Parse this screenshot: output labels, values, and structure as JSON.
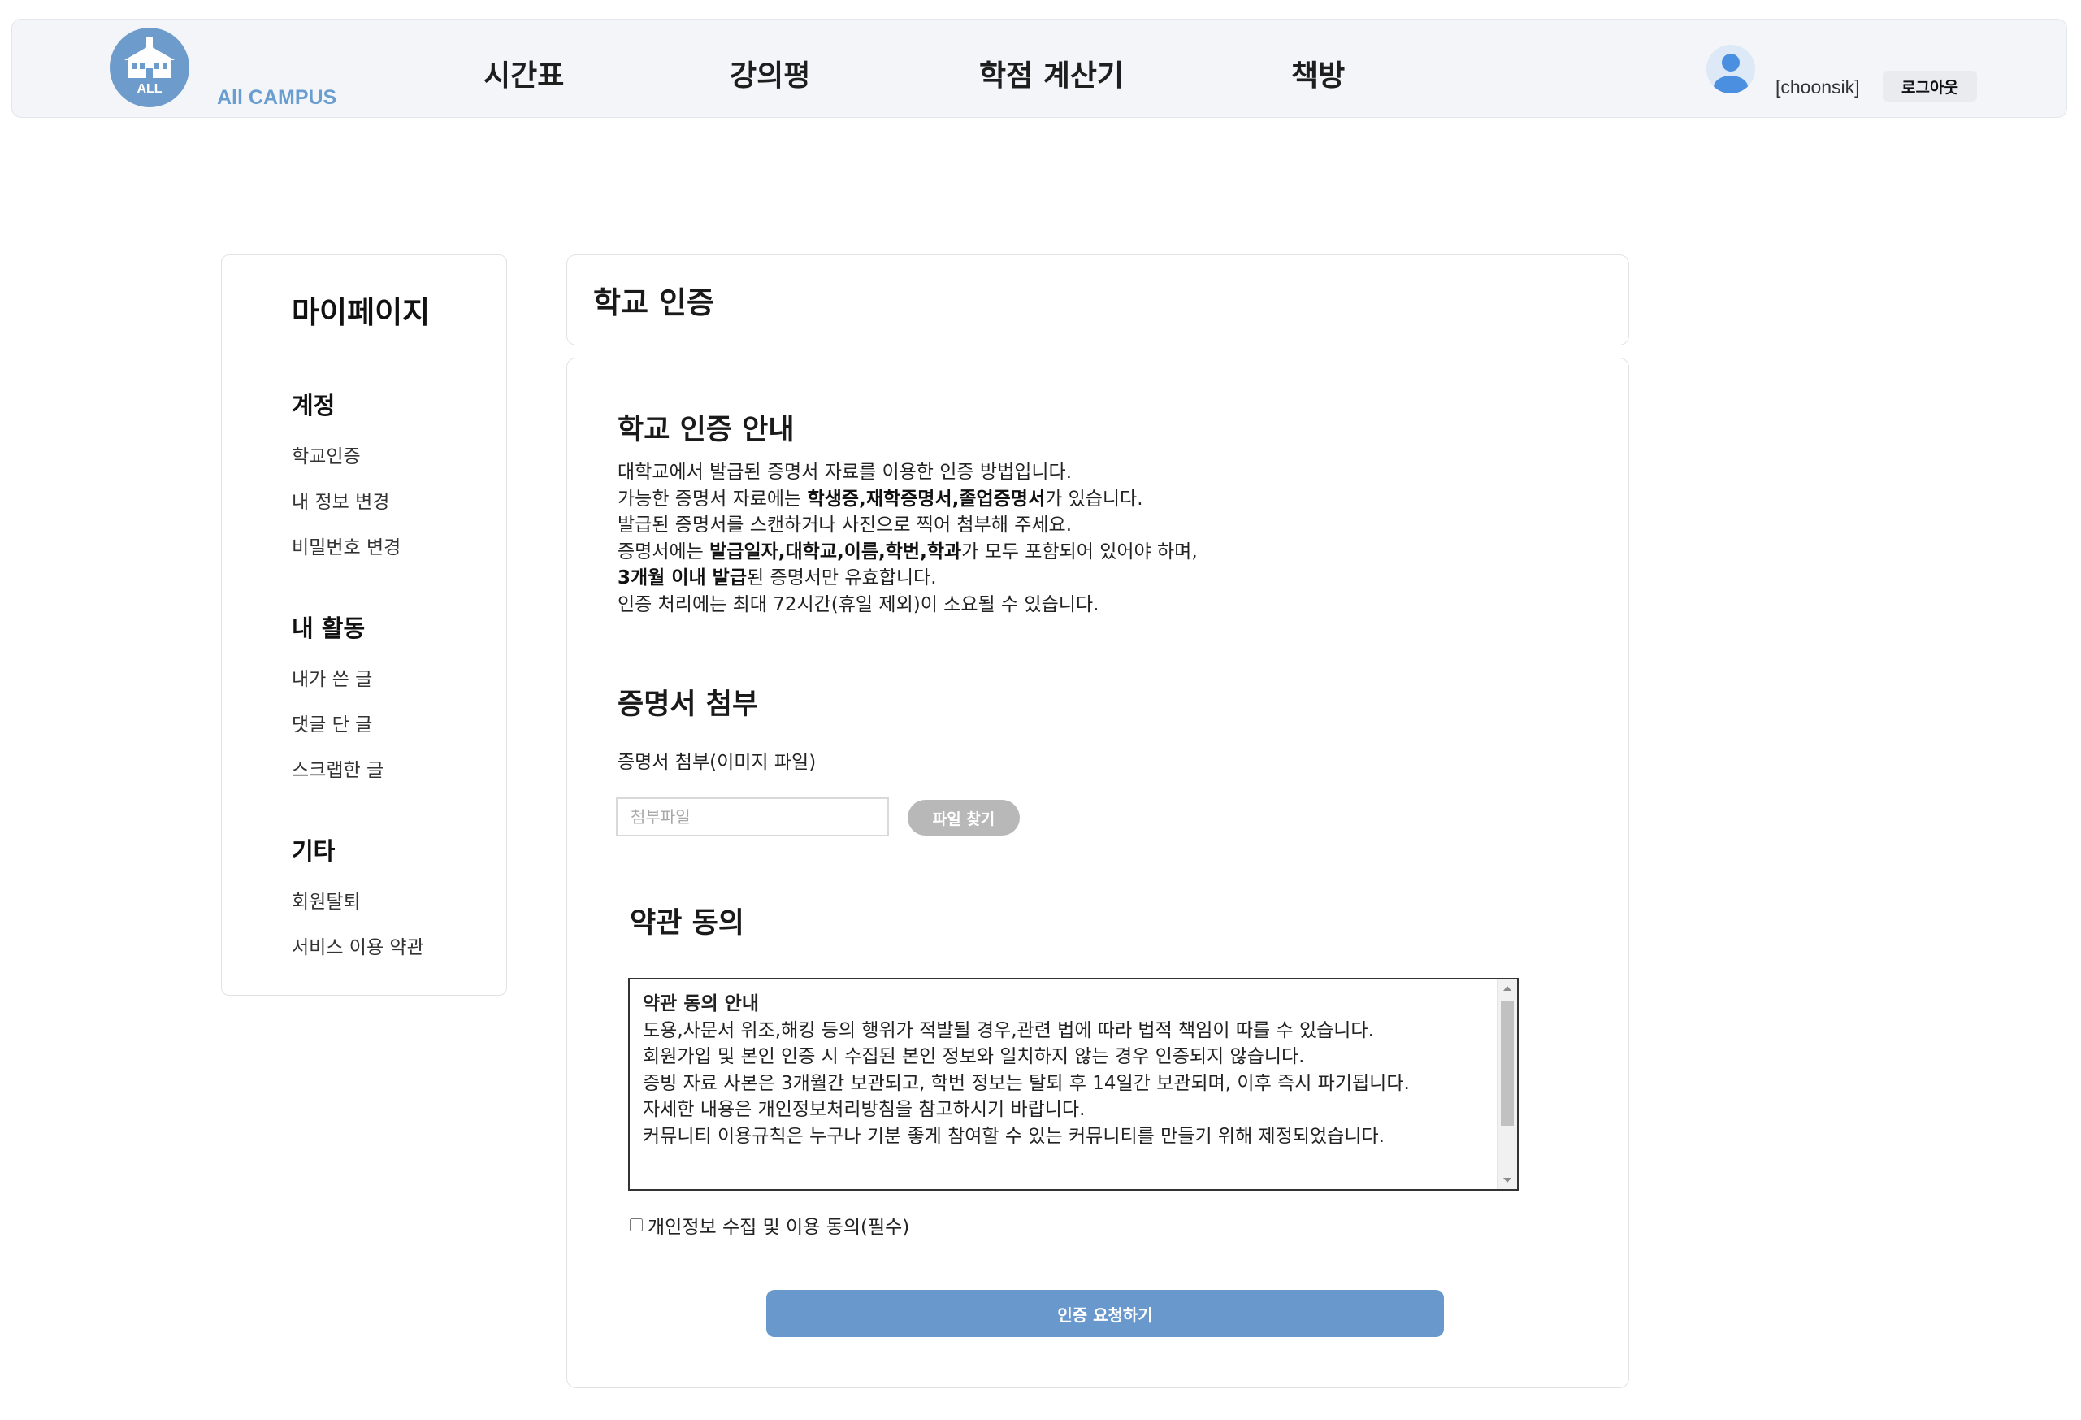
{
  "header": {
    "logo_text": "ALL",
    "brand": "All CAMPUS",
    "nav": [
      "시간표",
      "강의평",
      "학점 계산기",
      "책방"
    ],
    "username": "[choonsik]",
    "logout_label": "로그아웃"
  },
  "sidebar": {
    "title": "마이페이지",
    "sections": [
      {
        "title": "계정",
        "items": [
          "학교인증",
          "내 정보 변경",
          "비밀번호 변경"
        ]
      },
      {
        "title": "내 활동",
        "items": [
          "내가 쓴 글",
          "댓글 단 글",
          "스크랩한 글"
        ]
      },
      {
        "title": "기타",
        "items": [
          "회원탈퇴",
          "서비스 이용 약관"
        ]
      }
    ]
  },
  "main": {
    "page_title": "학교 인증",
    "guide": {
      "title": "학교 인증 안내",
      "line1": "대학교에서 발급된 증명서 자료를 이용한 인증 방법입니다.",
      "line2_pre": "가능한 증명서 자료에는 ",
      "line2_bold": "학생증,재학증명서,졸업증명서",
      "line2_post": "가 있습니다.",
      "line3": "발급된 증명서를 스캔하거나 사진으로 찍어 첨부해 주세요.",
      "line4_pre": "증명서에는 ",
      "line4_bold": "발급일자,대학교,이름,학번,학과",
      "line4_post": "가 모두 포함되어 있어야 하며,",
      "line5_bold": "3개월 이내 발급",
      "line5_post": "된 증명서만 유효합니다.",
      "line6": "인증 처리에는 최대 72시간(휴일 제외)이 소요될 수 있습니다."
    },
    "attach": {
      "title": "증명서 첨부",
      "label": "증명서 첨부(이미지 파일)",
      "placeholder": "첨부파일",
      "button": "파일 찾기"
    },
    "terms": {
      "title": "약관 동의",
      "heading": "약관 동의 안내",
      "lines": [
        "도용,사문서 위조,해킹 등의 행위가 적발될 경우,관련 법에 따라 법적 책임이 따를 수 있습니다.",
        "회원가입 및 본인 인증 시 수집된 본인 정보와 일치하지 않는 경우 인증되지 않습니다.",
        "증빙 자료 사본은 3개월간 보관되고, 학번 정보는 탈퇴 후 14일간 보관되며, 이후 즉시 파기됩니다.",
        "자세한 내용은 개인정보처리방침을 참고하시기 바랍니다.",
        "커뮤니티 이용규칙은 누구나 기분 좋게 참여할 수 있는 커뮤니티를 만들기 위해 제정되었습니다."
      ],
      "agree_label": "개인정보 수집 및 이용 동의(필수)"
    },
    "submit_label": "인증 요청하기"
  },
  "colors": {
    "accent": "#6898cc",
    "brand": "#6a9ed0",
    "header_bg": "#f3f5f9",
    "disabled_button": "#b8b8b8"
  }
}
